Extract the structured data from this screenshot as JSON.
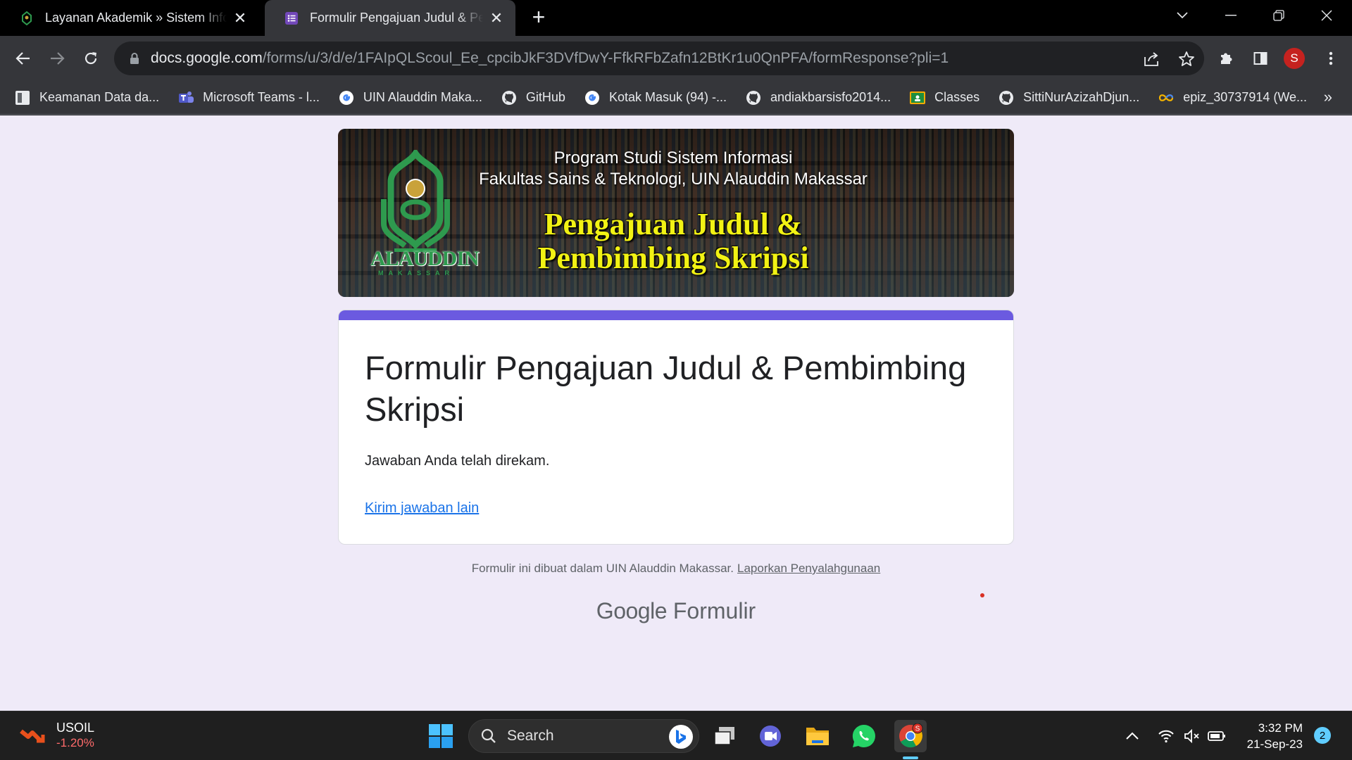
{
  "tabs": [
    {
      "title": "Layanan Akademik » Sistem Informasi",
      "active": false,
      "favicon": "uin-logo-icon"
    },
    {
      "title": "Formulir Pengajuan Judul & Pembimbing Skripsi",
      "active": true,
      "favicon": "google-forms-icon"
    }
  ],
  "toolbar": {
    "url_host": "docs.google.com",
    "url_path": "/forms/u/3/d/e/1FAIpQLScoul_Ee_cpcibJkF3DVfDwY-FfkRFbZafn12BtKr1u0QnPFA/formResponse?pli=1",
    "profile_initial": "S"
  },
  "bookmarks": [
    {
      "label": "Keamanan Data da...",
      "icon": "doc-icon"
    },
    {
      "label": "Microsoft Teams - l...",
      "icon": "teams-icon"
    },
    {
      "label": "UIN Alauddin Maka...",
      "icon": "google-icon"
    },
    {
      "label": "GitHub",
      "icon": "github-icon"
    },
    {
      "label": "Kotak Masuk (94) -...",
      "icon": "google-icon"
    },
    {
      "label": "andiakbarsisfo2014...",
      "icon": "github-icon"
    },
    {
      "label": "Classes",
      "icon": "classroom-icon"
    },
    {
      "label": "SittiNurAzizahDjun...",
      "icon": "github-icon"
    },
    {
      "label": "epiz_30737914 (We...",
      "icon": "infinity-icon"
    }
  ],
  "banner": {
    "line1": "Program Studi Sistem Informasi",
    "line2": "Fakultas Sains & Teknologi, UIN Alauddin Makassar",
    "headline1": "Pengajuan Judul &",
    "headline2": "Pembimbing Skripsi",
    "logo_text": "ALAUDDIN",
    "logo_sub": "MAKASSAR"
  },
  "form": {
    "title": "Formulir Pengajuan Judul & Pembimbing Skripsi",
    "message": "Jawaban Anda telah direkam.",
    "link": "Kirim jawaban lain",
    "accent_color": "#6b5ae0"
  },
  "footer": {
    "note": "Formulir ini dibuat dalam UIN Alauddin Makassar.",
    "report": "Laporkan Penyalahgunaan",
    "brand_google": "Google",
    "brand_forms": "Formulir"
  },
  "taskbar": {
    "stock_name": "USOIL",
    "stock_change": "-1.20%",
    "search_placeholder": "Search",
    "time": "3:32 PM",
    "date": "21-Sep-23",
    "notification_count": "2",
    "chrome_badge": "S"
  }
}
